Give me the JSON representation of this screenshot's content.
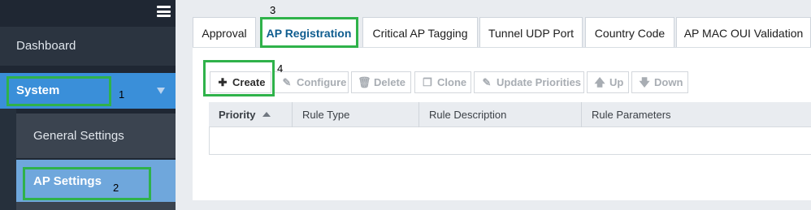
{
  "sidebar": {
    "menu_icon": "hamburger-menu-icon",
    "dashboard": "Dashboard",
    "system": "System",
    "system_expand_icon": "triangle-down-icon",
    "general_settings": "General Settings",
    "ap_settings": "AP Settings"
  },
  "tabs": [
    {
      "label": "Approval",
      "active": false
    },
    {
      "label": "AP Registration",
      "active": true
    },
    {
      "label": "Critical AP Tagging",
      "active": false
    },
    {
      "label": "Tunnel UDP Port",
      "active": false
    },
    {
      "label": "Country Code",
      "active": false
    },
    {
      "label": "AP MAC OUI Validation",
      "active": false
    }
  ],
  "toolbar": [
    {
      "label": "Create",
      "icon": "plus-icon",
      "enabled": true
    },
    {
      "label": "Configure",
      "icon": "pencil-icon",
      "enabled": false
    },
    {
      "label": "Delete",
      "icon": "trash-icon",
      "enabled": false
    },
    {
      "label": "Clone",
      "icon": "clone-icon",
      "enabled": false
    },
    {
      "label": "Update Priorities",
      "icon": "pencil-icon",
      "enabled": false
    },
    {
      "label": "Up",
      "icon": "arrow-up-icon",
      "enabled": false
    },
    {
      "label": "Down",
      "icon": "arrow-down-icon",
      "enabled": false
    }
  ],
  "table": {
    "columns": [
      "Priority",
      "Rule Type",
      "Rule Description",
      "Rule Parameters"
    ],
    "sorted_column": "Priority",
    "sort_direction": "ascending",
    "rows": []
  },
  "annotations": [
    "1",
    "2",
    "3",
    "4"
  ],
  "colors": {
    "sidebar_bg": "#1f2733",
    "system_active": "#3a8fd9",
    "ap_settings_active": "#6fa7dc",
    "annotation_box": "#2fb24a",
    "active_tab_text": "#0f5d8f"
  }
}
